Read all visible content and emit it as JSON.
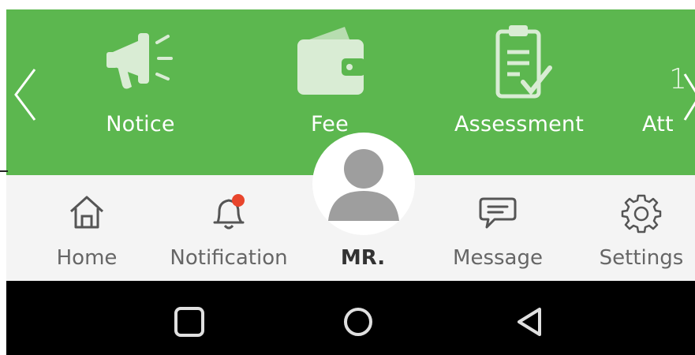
{
  "menu": {
    "items": [
      {
        "label": "Notice",
        "icon": "megaphone-icon"
      },
      {
        "label": "Fee",
        "icon": "wallet-icon"
      },
      {
        "label": "Assessment",
        "icon": "clipboard-check-icon"
      },
      {
        "label": "Att",
        "icon": ""
      }
    ],
    "page_indicator": "1"
  },
  "bottom_nav": {
    "tabs": [
      {
        "label": "Home",
        "icon": "home-icon"
      },
      {
        "label": "Notification",
        "icon": "bell-icon"
      },
      {
        "label": "MR.",
        "icon": "avatar-icon"
      },
      {
        "label": "Message",
        "icon": "chat-icon"
      },
      {
        "label": "Settings",
        "icon": "gear-icon"
      }
    ]
  },
  "colors": {
    "header_green": "#5cb74f",
    "nav_bg": "#f4f4f4",
    "badge_red": "#e8452c",
    "icon_light": "#d9ecd4"
  }
}
